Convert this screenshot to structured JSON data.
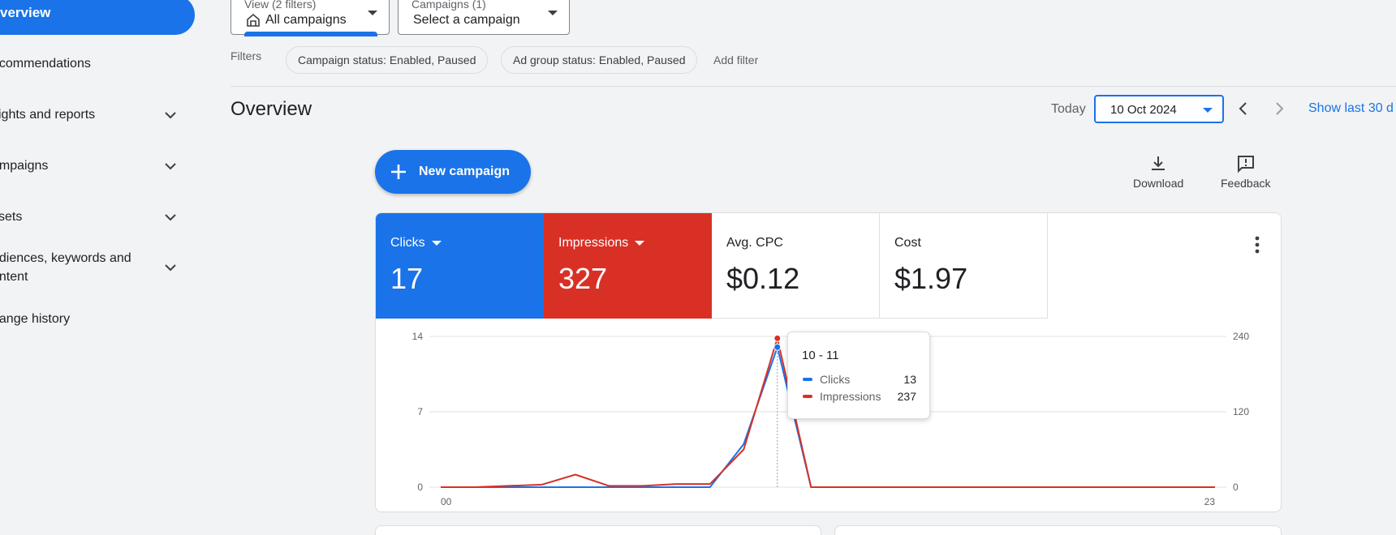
{
  "sidebar": {
    "active": "verview",
    "items": [
      {
        "label": "ecommendations",
        "expandable": false
      },
      {
        "label": "sights and reports",
        "expandable": true
      },
      {
        "label": "ampaigns",
        "expandable": true
      },
      {
        "label": "ssets",
        "expandable": true
      },
      {
        "label_line1": "udiences, keywords and",
        "label_line2": "ontent",
        "expandable": true
      },
      {
        "label": "hange history",
        "expandable": false
      }
    ]
  },
  "selectors": {
    "view": {
      "small": "View (2 filters)",
      "value": "All campaigns"
    },
    "campaigns": {
      "small": "Campaigns (1)",
      "value": "Select a campaign"
    }
  },
  "filters": {
    "label": "Filters",
    "chips": [
      "Campaign status: Enabled, Paused",
      "Ad group status: Enabled, Paused"
    ],
    "add": "Add filter"
  },
  "header": {
    "title": "Overview",
    "today": "Today",
    "date": "10 Oct 2024",
    "show_last": "Show last 30 d"
  },
  "actions": {
    "new_campaign": "New campaign",
    "download": "Download",
    "feedback": "Feedback"
  },
  "metrics": [
    {
      "label": "Clicks",
      "value": "17",
      "color": "#1a73e8"
    },
    {
      "label": "Impressions",
      "value": "327",
      "color": "#d93025"
    },
    {
      "label": "Avg. CPC",
      "value": "$0.12"
    },
    {
      "label": "Cost",
      "value": "$1.97"
    }
  ],
  "tooltip": {
    "title": "10 - 11",
    "rows": [
      {
        "name": "Clicks",
        "value": "13",
        "color": "#1a73e8"
      },
      {
        "name": "Impressions",
        "value": "237",
        "color": "#d93025"
      }
    ]
  },
  "chart_data": {
    "type": "line",
    "x_tick_labels": [
      "00",
      "23"
    ],
    "x": [
      0,
      1,
      2,
      3,
      4,
      5,
      6,
      7,
      8,
      9,
      10,
      11,
      12,
      13,
      14,
      15,
      16,
      17,
      18,
      19,
      20,
      21,
      22,
      23
    ],
    "y_left": {
      "ticks": [
        0,
        7,
        14
      ],
      "ylim": [
        0,
        14
      ]
    },
    "y_right": {
      "ticks": [
        0,
        120,
        240
      ],
      "ylim": [
        0,
        240
      ]
    },
    "series": [
      {
        "name": "Clicks",
        "axis": "left",
        "color": "#1a73e8",
        "values": [
          0,
          0,
          0,
          0,
          0,
          0,
          0,
          0,
          0,
          4,
          13,
          0,
          0,
          0,
          0,
          0,
          0,
          0,
          0,
          0,
          0,
          0,
          0,
          0
        ]
      },
      {
        "name": "Impressions",
        "axis": "right",
        "color": "#d93025",
        "values": [
          0,
          0,
          2,
          4,
          20,
          2,
          2,
          5,
          5,
          60,
          237,
          0,
          0,
          0,
          0,
          0,
          0,
          0,
          0,
          0,
          0,
          0,
          0,
          0
        ]
      }
    ],
    "highlight_index": 10,
    "grid": true
  }
}
